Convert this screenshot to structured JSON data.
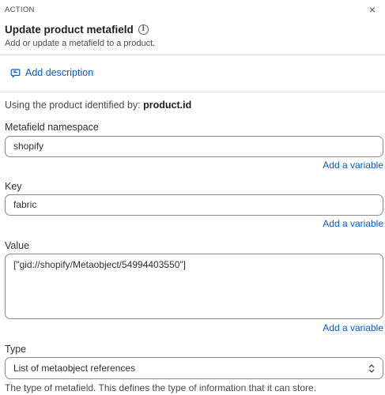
{
  "header": {
    "kicker": "ACTION",
    "close_icon": "×",
    "title": "Update product metafield",
    "info_icon": "i",
    "subtitle": "Add or update a metafield to a product."
  },
  "description": {
    "add_label": "Add description",
    "icon": "comment-edit-icon"
  },
  "context": {
    "prefix": "Using the product identified by:",
    "identifier": "product.id"
  },
  "fields": {
    "namespace": {
      "label": "Metafield namespace",
      "value": "shopify",
      "add_variable": "Add a variable"
    },
    "key": {
      "label": "Key",
      "value": "fabric",
      "add_variable": "Add a variable"
    },
    "value": {
      "label": "Value",
      "value": "[\"gid://shopify/Metaobject/54994403550\"]",
      "add_variable": "Add a variable"
    },
    "type": {
      "label": "Type",
      "selected": "List of metaobject references",
      "help": "The type of metafield. This defines the type of information that it can store."
    }
  },
  "colors": {
    "link": "#005bd3",
    "border": "#8a8a8a",
    "divider": "#e3e3e3"
  }
}
